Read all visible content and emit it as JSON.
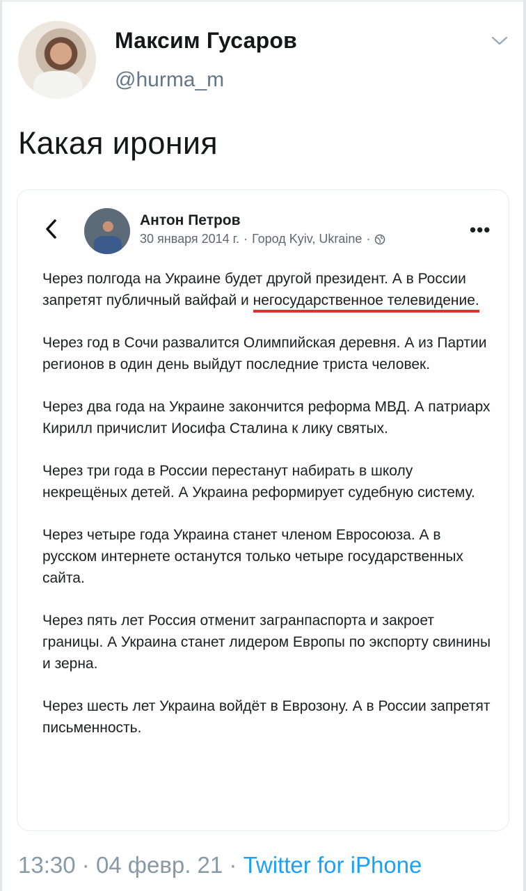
{
  "tweet": {
    "author_name": "Максим Гусаров",
    "author_handle": "@hurma_m",
    "text": "Какая ирония",
    "time": "13:30",
    "separator": "·",
    "date": "04 февр. 21",
    "source": "Twitter for iPhone"
  },
  "embedded_post": {
    "author_name": "Антон Петров",
    "date": "30 января 2014 г.",
    "separator": "·",
    "location": "Город Kyiv, Ukraine",
    "paragraphs": [
      "Через полгода на Украине будет другой президент. А в России запретят публичный вайфай и",
      "Через год в Сочи развалится Олимпийская деревня. А из Партии регионов в один день выйдут последние триста человек.",
      "Через два года на Украине закончится реформа МВД. А патриарх Кирилл причислит Иосифа Сталина к лику святых.",
      "Через три года в России перестанут набирать в школу некрещёных детей. А Украина реформирует судебную систему.",
      "Через четыре года Украина станет членом Евросоюза. А в русском интернете останутся только четыре государственных сайта.",
      "Через пять лет Россия отменит загранпаспорта и закроет границы. А Украина станет лидером Европы по экспорту свинины и зерна.",
      "Через шесть лет Украина войдёт в Еврозону. А в России запретят письменность."
    ],
    "highlighted_text": "негосударственное телевидение."
  },
  "colors": {
    "handle": "#657786",
    "link": "#1da1f2",
    "underline": "#e0312c"
  },
  "icons": [
    "chevron-down-icon",
    "back-arrow-icon",
    "globe-icon",
    "more-options-icon"
  ]
}
